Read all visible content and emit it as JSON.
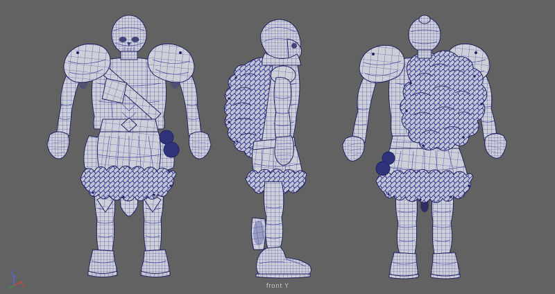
{
  "viewport": {
    "camera_label": "front Y",
    "background_color": "#626262",
    "label_color": "#c9c9c9"
  },
  "model": {
    "wireframe_color": "#2e2f93",
    "wireframe_dark_color": "#20215f",
    "surface_color": "#ced0d9",
    "fur_surface_color": "#c1c4d3",
    "pouch_color": "#2f3379",
    "views": [
      {
        "id": "front",
        "description": "armored character wireframe, front view"
      },
      {
        "id": "side",
        "description": "armored character wireframe, side view facing right"
      },
      {
        "id": "back",
        "description": "armored character wireframe, back view"
      }
    ]
  },
  "axis_gizmo": {
    "x_label": "x",
    "y_label": "y",
    "x_color": "#c14b42",
    "y_color": "#5568d4",
    "z_color": "#3f9040"
  }
}
